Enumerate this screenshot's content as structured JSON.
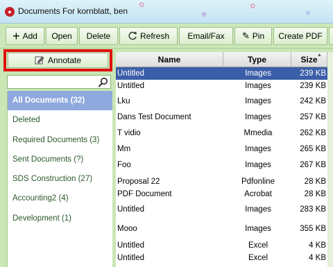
{
  "window": {
    "title": "Documents For kornblatt, ben"
  },
  "toolbar": {
    "add": "Add",
    "open": "Open",
    "delete": "Delete",
    "refresh": "Refresh",
    "email_fax": "Email/Fax",
    "pin": "Pin",
    "create_pdf": "Create PDF"
  },
  "sidebar": {
    "annotate": "Annotate",
    "folders": [
      {
        "label": "All Documents (32)"
      },
      {
        "label": "Deleted"
      },
      {
        "label": "Required Documents (3)"
      },
      {
        "label": "Sent Documents (?)"
      },
      {
        "label": "SDS Construction (27)"
      },
      {
        "label": "Accounting2 (4)"
      },
      {
        "label": "Development (1)"
      }
    ]
  },
  "grid": {
    "columns": {
      "name": "Name",
      "type": "Type",
      "size": "Size"
    },
    "rows": [
      {
        "name": "Untitled",
        "type": "Images",
        "size": "239 KB"
      },
      {
        "name": "Untitled",
        "type": "Images",
        "size": "239 KB"
      },
      {
        "name": "Lku",
        "type": "Images",
        "size": "242 KB"
      },
      {
        "name": "Dans Test Document",
        "type": "Images",
        "size": "257 KB"
      },
      {
        "name": "T vidio",
        "type": "Mmedia",
        "size": "262 KB"
      },
      {
        "name": "Mm",
        "type": "Images",
        "size": "265 KB"
      },
      {
        "name": "Foo",
        "type": "Images",
        "size": "267 KB"
      },
      {
        "name": "Proposal 22",
        "type": "Pdfonline",
        "size": "28 KB"
      },
      {
        "name": "PDF Document",
        "type": "Acrobat",
        "size": "28 KB"
      },
      {
        "name": "Untitled",
        "type": "Images",
        "size": "283 KB"
      },
      {
        "name": "Mooo",
        "type": "Images",
        "size": "355 KB"
      },
      {
        "name": "Untitled",
        "type": "Excel",
        "size": "4 KB"
      },
      {
        "name": "Untitled",
        "type": "Excel",
        "size": "4 KB"
      }
    ]
  },
  "colors": {
    "highlight_box": "#e01010",
    "selected_row": "#3b5ea8",
    "selected_folder": "#8fa9de",
    "toolbar_bg": "#cce8b8"
  }
}
